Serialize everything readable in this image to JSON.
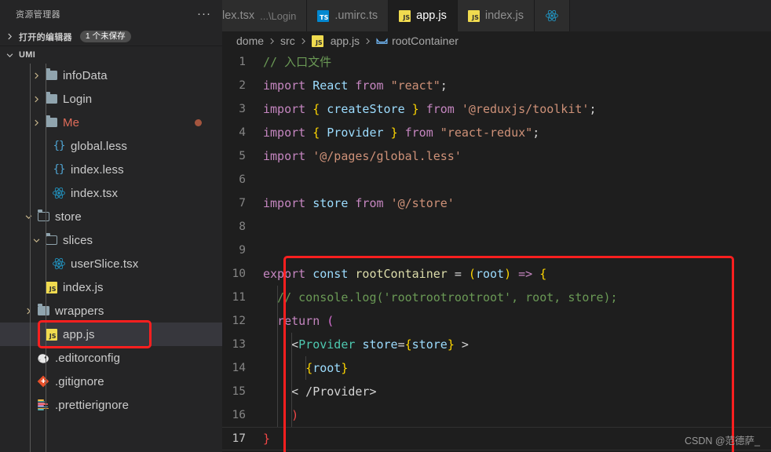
{
  "sidebar": {
    "title": "资源管理器",
    "more_label": "···",
    "sections": [
      {
        "label": "打开的编辑器",
        "badge": "1 个未保存",
        "expanded": false
      },
      {
        "label": "UMI",
        "badge": "",
        "expanded": true
      }
    ],
    "tree": [
      {
        "label": "infoData",
        "icon": "folder",
        "indent": 3,
        "twisty": "collapsed",
        "state": "normal",
        "dirty": false,
        "selected": false
      },
      {
        "label": "Login",
        "icon": "folder",
        "indent": 3,
        "twisty": "collapsed",
        "state": "normal",
        "dirty": false,
        "selected": false
      },
      {
        "label": "Me",
        "icon": "folder",
        "indent": 3,
        "twisty": "collapsed",
        "state": "modified-strong",
        "dirty": true,
        "selected": false
      },
      {
        "label": "global.less",
        "icon": "less",
        "indent": 4,
        "twisty": "none",
        "state": "normal",
        "dirty": false,
        "selected": false
      },
      {
        "label": "index.less",
        "icon": "less",
        "indent": 4,
        "twisty": "none",
        "state": "normal",
        "dirty": false,
        "selected": false
      },
      {
        "label": "index.tsx",
        "icon": "react",
        "indent": 4,
        "twisty": "none",
        "state": "normal",
        "dirty": false,
        "selected": false
      },
      {
        "label": "store",
        "icon": "folder-open",
        "indent": 2,
        "twisty": "expanded",
        "state": "normal",
        "dirty": false,
        "selected": false
      },
      {
        "label": "slices",
        "icon": "folder-open",
        "indent": 3,
        "twisty": "expanded",
        "state": "normal",
        "dirty": false,
        "selected": false
      },
      {
        "label": "userSlice.tsx",
        "icon": "react",
        "indent": 4,
        "twisty": "none",
        "state": "normal",
        "dirty": false,
        "selected": false
      },
      {
        "label": "index.js",
        "icon": "js",
        "indent": 3,
        "twisty": "none",
        "state": "normal",
        "dirty": false,
        "selected": false
      },
      {
        "label": "wrappers",
        "icon": "folder",
        "indent": 2,
        "twisty": "collapsed",
        "state": "normal",
        "dirty": false,
        "selected": false
      },
      {
        "label": "app.js",
        "icon": "js",
        "indent": 3,
        "twisty": "none",
        "state": "normal",
        "dirty": false,
        "selected": true
      },
      {
        "label": ".editorconfig",
        "icon": "editorconfig",
        "indent": 2,
        "twisty": "none",
        "state": "normal",
        "dirty": false,
        "selected": false
      },
      {
        "label": ".gitignore",
        "icon": "git",
        "indent": 2,
        "twisty": "none",
        "state": "normal",
        "dirty": false,
        "selected": false
      },
      {
        "label": ".prettierignore",
        "icon": "prettier",
        "indent": 2,
        "twisty": "none",
        "state": "normal",
        "dirty": false,
        "selected": false
      }
    ]
  },
  "tabs": [
    {
      "name": "lex.tsx",
      "path": "...\\Login",
      "icon": "none",
      "active": false,
      "clipped": true
    },
    {
      "name": ".umirc.ts",
      "path": "",
      "icon": "ts",
      "active": false,
      "clipped": false
    },
    {
      "name": "app.js",
      "path": "",
      "icon": "js",
      "active": true,
      "clipped": false
    },
    {
      "name": "index.js",
      "path": "",
      "icon": "js",
      "active": false,
      "clipped": false
    },
    {
      "name": "",
      "path": "",
      "icon": "react",
      "active": false,
      "clipped": false
    }
  ],
  "breadcrumb": [
    {
      "label": "dome",
      "icon": "none"
    },
    {
      "label": "src",
      "icon": "none"
    },
    {
      "label": "app.js",
      "icon": "js"
    },
    {
      "label": "rootContainer",
      "icon": "symbol-variable"
    }
  ],
  "editor": {
    "lines": [
      {
        "n": "1",
        "tokens": [
          {
            "t": "// 入口文件",
            "c": "t-cmt"
          }
        ]
      },
      {
        "n": "2",
        "tokens": [
          {
            "t": "import ",
            "c": "t-kw"
          },
          {
            "t": "React",
            "c": "t-id"
          },
          {
            "t": " ",
            "c": "t-pun"
          },
          {
            "t": "from",
            "c": "t-kw"
          },
          {
            "t": " ",
            "c": "t-pun"
          },
          {
            "t": "\"react\"",
            "c": "t-str"
          },
          {
            "t": ";",
            "c": "t-pun"
          }
        ]
      },
      {
        "n": "3",
        "tokens": [
          {
            "t": "import ",
            "c": "t-kw"
          },
          {
            "t": "{",
            "c": "t-br1"
          },
          {
            "t": " ",
            "c": "t-pun"
          },
          {
            "t": "createStore",
            "c": "t-id"
          },
          {
            "t": " ",
            "c": "t-pun"
          },
          {
            "t": "}",
            "c": "t-br1"
          },
          {
            "t": " ",
            "c": "t-pun"
          },
          {
            "t": "from",
            "c": "t-kw"
          },
          {
            "t": " ",
            "c": "t-pun"
          },
          {
            "t": "'@reduxjs/toolkit'",
            "c": "t-str"
          },
          {
            "t": ";",
            "c": "t-pun"
          }
        ]
      },
      {
        "n": "4",
        "tokens": [
          {
            "t": "import ",
            "c": "t-kw"
          },
          {
            "t": "{",
            "c": "t-br1"
          },
          {
            "t": " ",
            "c": "t-pun"
          },
          {
            "t": "Provider",
            "c": "t-id"
          },
          {
            "t": " ",
            "c": "t-pun"
          },
          {
            "t": "}",
            "c": "t-br1"
          },
          {
            "t": " ",
            "c": "t-pun"
          },
          {
            "t": "from",
            "c": "t-kw"
          },
          {
            "t": " ",
            "c": "t-pun"
          },
          {
            "t": "\"react-redux\"",
            "c": "t-str"
          },
          {
            "t": ";",
            "c": "t-pun"
          }
        ]
      },
      {
        "n": "5",
        "tokens": [
          {
            "t": "import ",
            "c": "t-kw"
          },
          {
            "t": "'@/pages/global.less'",
            "c": "t-str"
          }
        ]
      },
      {
        "n": "6",
        "tokens": []
      },
      {
        "n": "7",
        "tokens": [
          {
            "t": "import ",
            "c": "t-kw"
          },
          {
            "t": "store",
            "c": "t-id"
          },
          {
            "t": " ",
            "c": "t-pun"
          },
          {
            "t": "from",
            "c": "t-kw"
          },
          {
            "t": " ",
            "c": "t-pun"
          },
          {
            "t": "'@/store'",
            "c": "t-str"
          }
        ]
      },
      {
        "n": "8",
        "tokens": []
      },
      {
        "n": "9",
        "tokens": []
      },
      {
        "n": "10",
        "tokens": [
          {
            "t": "export",
            "c": "t-kw"
          },
          {
            "t": " ",
            "c": "t-pun"
          },
          {
            "t": "const",
            "c": "t-id"
          },
          {
            "t": " ",
            "c": "t-pun"
          },
          {
            "t": "rootContainer",
            "c": "t-fn"
          },
          {
            "t": " ",
            "c": "t-pun"
          },
          {
            "t": "=",
            "c": "t-op"
          },
          {
            "t": " ",
            "c": "t-pun"
          },
          {
            "t": "(",
            "c": "t-br1"
          },
          {
            "t": "root",
            "c": "t-id"
          },
          {
            "t": ")",
            "c": "t-br1"
          },
          {
            "t": " ",
            "c": "t-pun"
          },
          {
            "t": "=>",
            "c": "t-kw"
          },
          {
            "t": " ",
            "c": "t-pun"
          },
          {
            "t": "{",
            "c": "t-br1"
          }
        ]
      },
      {
        "n": "11",
        "tokens": [
          {
            "t": "  // console.log('rootrootrootroot', root, store);",
            "c": "t-cmt"
          }
        ]
      },
      {
        "n": "12",
        "tokens": [
          {
            "t": "  ",
            "c": "t-pun"
          },
          {
            "t": "return",
            "c": "t-kw"
          },
          {
            "t": " ",
            "c": "t-pun"
          },
          {
            "t": "(",
            "c": "t-br2"
          }
        ]
      },
      {
        "n": "13",
        "tokens": [
          {
            "t": "    ",
            "c": "t-pun"
          },
          {
            "t": "<",
            "c": "t-pun"
          },
          {
            "t": "Provider",
            "c": "t-tag"
          },
          {
            "t": " ",
            "c": "t-pun"
          },
          {
            "t": "store",
            "c": "t-id"
          },
          {
            "t": "=",
            "c": "t-pun"
          },
          {
            "t": "{",
            "c": "t-br1"
          },
          {
            "t": "store",
            "c": "t-id"
          },
          {
            "t": "}",
            "c": "t-br1"
          },
          {
            "t": " ",
            "c": "t-pun"
          },
          {
            "t": ">",
            "c": "t-pun"
          }
        ]
      },
      {
        "n": "14",
        "tokens": [
          {
            "t": "      ",
            "c": "t-pun"
          },
          {
            "t": "{",
            "c": "t-br1"
          },
          {
            "t": "root",
            "c": "t-id"
          },
          {
            "t": "}",
            "c": "t-br1"
          }
        ]
      },
      {
        "n": "15",
        "tokens": [
          {
            "t": "    ",
            "c": "t-pun"
          },
          {
            "t": "< /Provider>",
            "c": "t-pun"
          }
        ]
      },
      {
        "n": "16",
        "tokens": [
          {
            "t": "    ",
            "c": "t-pun"
          },
          {
            "t": ")",
            "c": "t-red"
          }
        ]
      },
      {
        "n": "17",
        "tokens": [
          {
            "t": "}",
            "c": "t-red"
          }
        ]
      }
    ],
    "current_line": "17"
  },
  "watermark": "CSDN @范德萨_",
  "colors": {
    "accent_red": "#fc1f1f",
    "editor_bg": "#1e1e1e",
    "sidebar_bg": "#252526",
    "selection_bg": "#37373d",
    "tab_active_bg": "#1e1e1e",
    "comment_green": "#6a9955",
    "keyword_purple": "#c586c0",
    "string_orange": "#ce9178",
    "identifier_blue": "#9cdcfe",
    "bracket_yellow": "#ffd700",
    "unmatched_red": "#f44747"
  }
}
